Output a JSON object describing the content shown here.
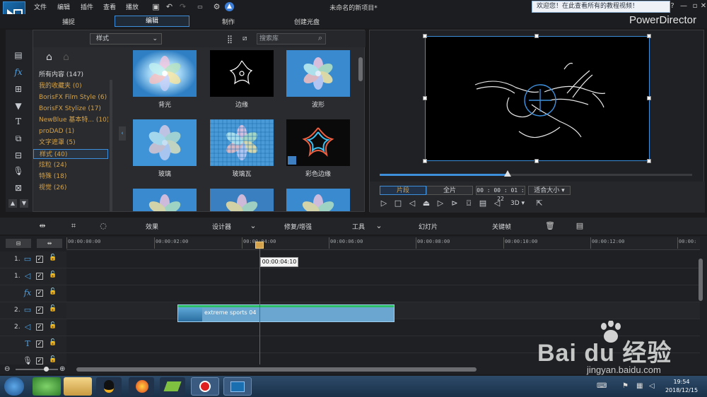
{
  "app": {
    "project_title": "未命名的新项目*",
    "brand": "PowerDirector",
    "welcome_text": "欢迎您！在此查看所有的教程视频！"
  },
  "menu": [
    "文件",
    "编辑",
    "插件",
    "查看",
    "播放"
  ],
  "modes": {
    "capture": "捕捉",
    "edit": "编辑",
    "produce": "制作",
    "disc": "创建光盘"
  },
  "library": {
    "style_select": "样式",
    "search_placeholder": "搜索库",
    "categories": [
      {
        "label": "所有内容 (147)"
      },
      {
        "label": "我的收藏夹 (0)"
      },
      {
        "label": "BorisFX Film Style (6)"
      },
      {
        "label": "BorisFX Stylize (17)"
      },
      {
        "label": "NewBlue 基本特... (10)"
      },
      {
        "label": "proDAD (1)"
      },
      {
        "label": "文字遮罩 (5)"
      },
      {
        "label": "样式 (40)"
      },
      {
        "label": "炫粒 (24)"
      },
      {
        "label": "特殊 (18)"
      },
      {
        "label": "视觉 (26)"
      }
    ],
    "effects": [
      {
        "label": "背光"
      },
      {
        "label": "边缘"
      },
      {
        "label": "波形"
      },
      {
        "label": "玻璃"
      },
      {
        "label": "玻璃瓦"
      },
      {
        "label": "彩色边缘"
      }
    ]
  },
  "preview": {
    "tab_clip": "片段",
    "tab_movie": "全片",
    "timecode": "00 : 00 : 01 : 22",
    "fit": "适合大小",
    "three_d": "3D",
    "progress": 0.41
  },
  "edit_toolbar": {
    "effect": "效果",
    "designer": "设计器",
    "fix": "修复/增强",
    "tools": "工具",
    "slideshow": "幻灯片",
    "keyframe": "关键帧"
  },
  "timeline": {
    "ticks": [
      "00:00:00:00",
      "00:00:02:00",
      "00:00:04:00",
      "00:00:06:00",
      "00:00:08:00",
      "00:00:10:00",
      "00:00:12:00",
      "00:00:"
    ],
    "tooltip": "00:00:04:10",
    "clip_label": "extreme sports 04",
    "tracks": [
      {
        "num": "1.",
        "icon": "video-track-icon"
      },
      {
        "num": "1.",
        "icon": "audio-track-icon"
      },
      {
        "num": "",
        "icon": "fx-track-icon"
      },
      {
        "num": "2.",
        "icon": "video-track-icon"
      },
      {
        "num": "2.",
        "icon": "audio-track-icon"
      },
      {
        "num": "",
        "icon": "title-track-icon"
      },
      {
        "num": "",
        "icon": "voice-track-icon"
      }
    ]
  },
  "taskbar": {
    "time": "19:54",
    "date": "2018/12/15"
  },
  "watermark": {
    "brand": "Bai du 经验",
    "url": "jingyan.baidu.com"
  },
  "colors": {
    "accent": "#3d8fdc",
    "category": "#d4a24a",
    "clip": "#6aa6cf",
    "playhead": "#e03030"
  }
}
